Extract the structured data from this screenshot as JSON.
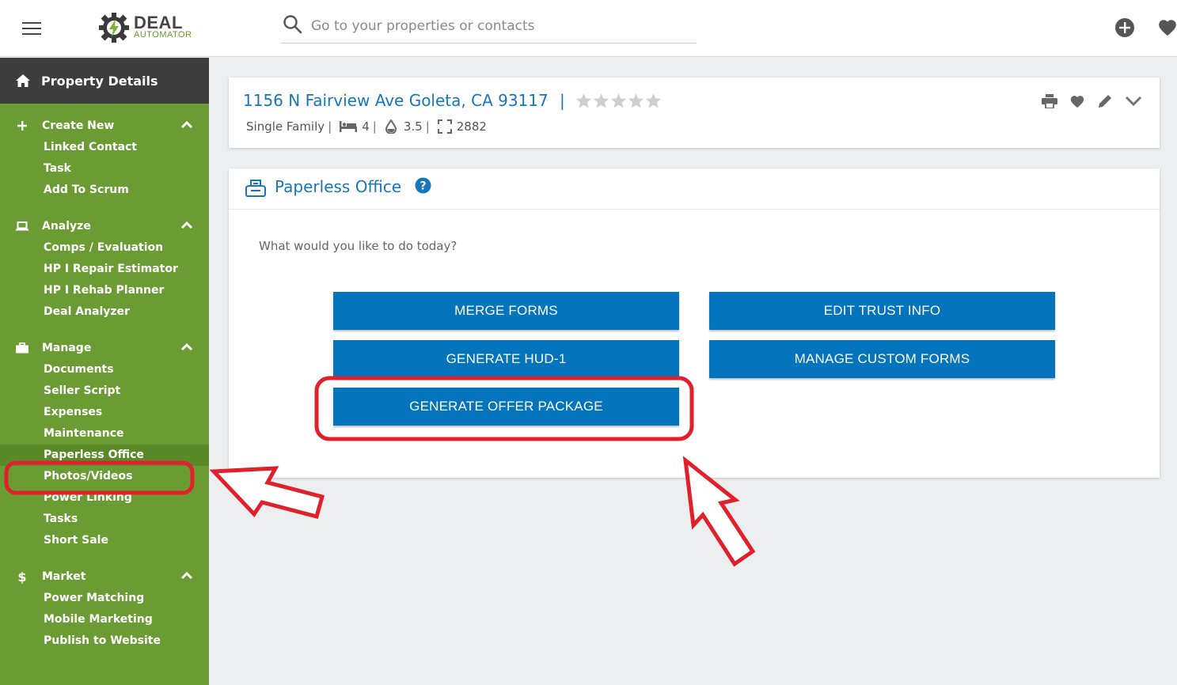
{
  "app": {
    "logo_text_top": "DEAL",
    "logo_text_bottom": "AUTOMATOR",
    "brand_green": "#6a9c33",
    "accent_blue": "#0474bd"
  },
  "search": {
    "placeholder": "Go to your properties or contacts"
  },
  "sidebar": {
    "header": "Property Details",
    "groups": [
      {
        "title": "Create New",
        "icon": "plus-icon",
        "items": [
          "Linked Contact",
          "Task",
          "Add To Scrum"
        ]
      },
      {
        "title": "Analyze",
        "icon": "laptop-icon",
        "items": [
          "Comps / Evaluation",
          "HP I Repair Estimator",
          "HP I Rehab Planner",
          "Deal Analyzer"
        ]
      },
      {
        "title": "Manage",
        "icon": "briefcase-icon",
        "items": [
          "Documents",
          "Seller Script",
          "Expenses",
          "Maintenance",
          "Paperless Office",
          "Photos/Videos",
          "Power Linking",
          "Tasks",
          "Short Sale"
        ]
      },
      {
        "title": "Market",
        "icon": "dollar-icon",
        "items": [
          "Power Matching",
          "Mobile Marketing",
          "Publish to Website"
        ]
      }
    ],
    "active_item": "Paperless Office"
  },
  "property": {
    "address": "1156 N Fairview Ave Goleta, CA 93117",
    "separator": "|",
    "rating_stars": 0,
    "type": "Single Family",
    "beds": "4",
    "baths": "3.5",
    "sqft": "2882",
    "pipe": "|"
  },
  "office": {
    "title": "Paperless Office",
    "prompt": "What would you like to do today?",
    "buttons": {
      "merge": "MERGE FORMS",
      "trust": "EDIT TRUST INFO",
      "hud": "GENERATE HUD-1",
      "custom": "MANAGE CUSTOM FORMS",
      "offer": "GENERATE OFFER PACKAGE"
    }
  },
  "annotation_color": "#e0202a"
}
